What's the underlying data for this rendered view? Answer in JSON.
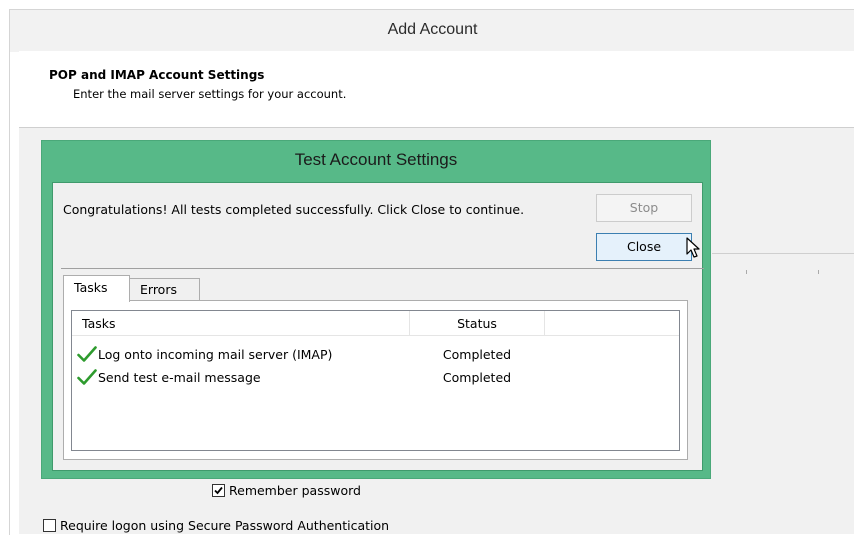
{
  "window": {
    "title": "Add Account"
  },
  "header": {
    "title": "POP and IMAP Account Settings",
    "subtitle": "Enter the mail server settings for your account."
  },
  "test_dialog": {
    "title": "Test Account Settings",
    "message": "Congratulations! All tests completed successfully. Click Close to continue.",
    "stop_label": "Stop",
    "close_label": "Close",
    "tabs": [
      {
        "label": "Tasks",
        "selected": true
      },
      {
        "label": "Errors",
        "selected": false
      }
    ],
    "columns": {
      "tasks": "Tasks",
      "status": "Status"
    },
    "rows": [
      {
        "task": "Log onto incoming mail server (IMAP)",
        "status": "Completed",
        "icon": "checkmark-icon"
      },
      {
        "task": "Send test e-mail message",
        "status": "Completed",
        "icon": "checkmark-icon"
      }
    ],
    "colors": {
      "frame": "#57b988",
      "checkmark": "#2e9b2e"
    }
  },
  "options": {
    "remember_password": {
      "label": "Remember password",
      "checked": true
    },
    "require_spa": {
      "label": "Require logon using Secure Password Authentication",
      "checked": false
    }
  }
}
